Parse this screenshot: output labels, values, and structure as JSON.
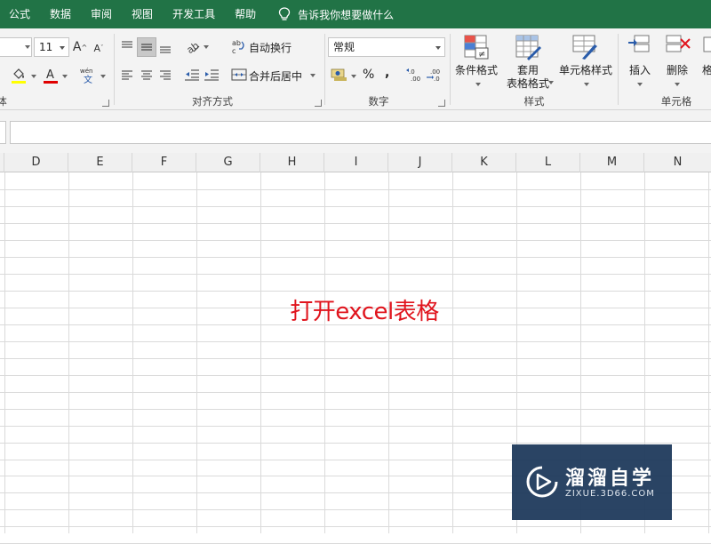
{
  "menu": {
    "tabs": [
      "公式",
      "数据",
      "审阅",
      "视图",
      "开发工具",
      "帮助"
    ],
    "tell_me": "告诉我你想要做什么"
  },
  "ribbon": {
    "font": {
      "font_name_value": "",
      "font_size_value": "11",
      "group_label_fragment": "体"
    },
    "alignment": {
      "wrap_text": "自动换行",
      "merge_center": "合并后居中",
      "group_label": "对齐方式"
    },
    "number": {
      "format_value": "常规",
      "percent": "%",
      "comma": ",",
      "group_label": "数字"
    },
    "styles": {
      "conditional_formatting": "条件格式",
      "format_as_table_line1": "套用",
      "format_as_table_line2": "表格格式",
      "cell_styles": "单元格样式",
      "group_label": "样式"
    },
    "cells": {
      "insert": "插入",
      "delete": "删除",
      "format_fragment": "格",
      "group_label": "单元格"
    }
  },
  "sheet": {
    "columns": [
      "D",
      "E",
      "F",
      "G",
      "H",
      "I",
      "J",
      "K",
      "L",
      "M",
      "N"
    ],
    "row_count": 22
  },
  "caption": "打开excel表格",
  "watermark": {
    "title": "溜溜自学",
    "url": "ZIXUE.3D66.COM"
  },
  "colors": {
    "menu_bg": "#217346",
    "caption": "#e0141d",
    "watermark_bg": "#1f3a5c"
  }
}
